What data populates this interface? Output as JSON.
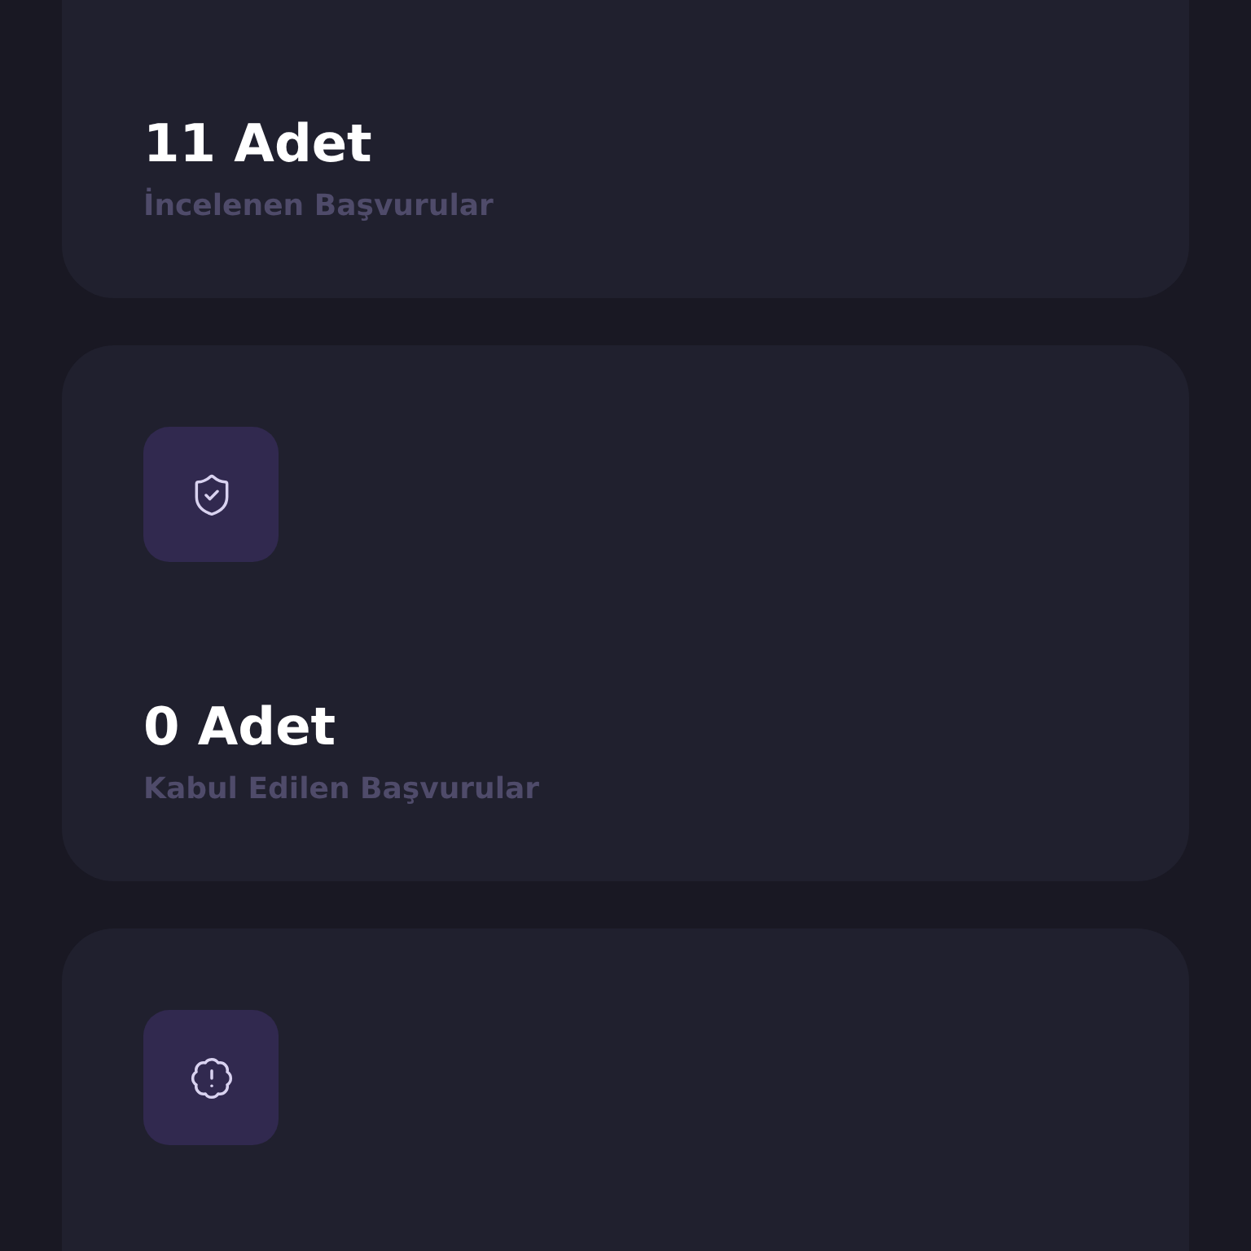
{
  "cards": [
    {
      "kind": "text",
      "value": "11 Adet",
      "label": "İncelenen Başvurular"
    },
    {
      "kind": "shield",
      "value": "0 Adet",
      "label": "Kabul Edilen Başvurular"
    },
    {
      "kind": "alert"
    }
  ]
}
